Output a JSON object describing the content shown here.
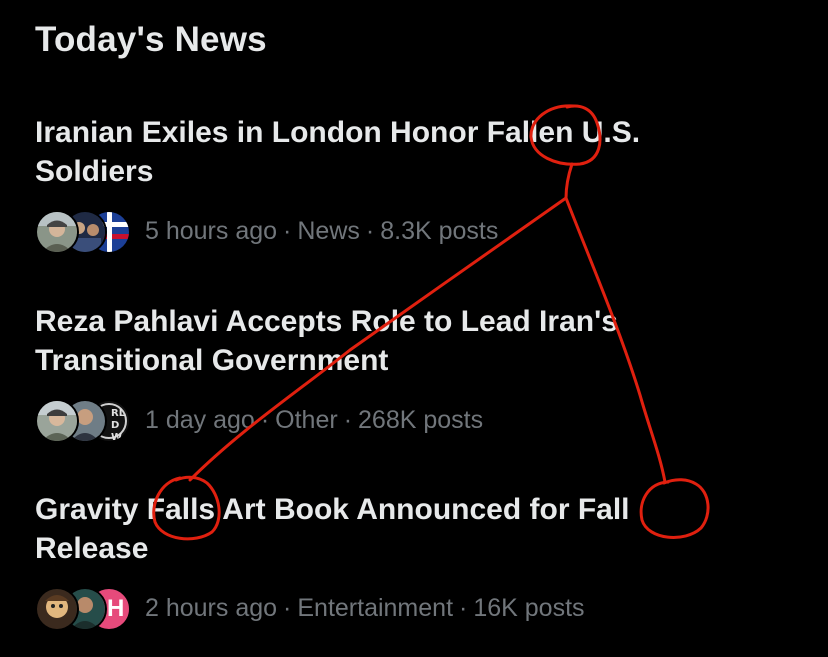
{
  "section": {
    "title": "Today's News"
  },
  "items": [
    {
      "headline_line1": "Iranian Exiles in London Honor Fallen U.S.",
      "headline_line2": "Soldiers",
      "time": "5 hours ago",
      "category": "News",
      "posts": "8.3K posts",
      "avatar_icons": [
        "person-avatar-icon",
        "group-photo-avatar-icon",
        "flag-avatar-icon"
      ]
    },
    {
      "headline_line1": "Reza Pahlavi Accepts Role to Lead Iran's",
      "headline_line2": "Transitional Government",
      "time": "1 day ago",
      "category": "Other",
      "posts": "268K posts",
      "avatar_icons": [
        "person-avatar-icon",
        "person-avatar-icon",
        "world-news-logo-avatar"
      ],
      "logo_text": "RLD WS"
    },
    {
      "headline_line1": "Gravity Falls Art Book Announced for Fall",
      "headline_line2": "Release",
      "time": "2 hours ago",
      "category": "Entertainment",
      "posts": "16K posts",
      "avatar_icons": [
        "cartoon-avatar-icon",
        "person-avatar-icon",
        "letter-h-logo-avatar"
      ],
      "logo_text": "H"
    }
  ],
  "meta_separator": "·",
  "colors": {
    "background": "#000000",
    "headline": "#e7e9ea",
    "meta": "#71767b",
    "annotation": "#e0200f",
    "logo_pink": "#e64a7b"
  }
}
